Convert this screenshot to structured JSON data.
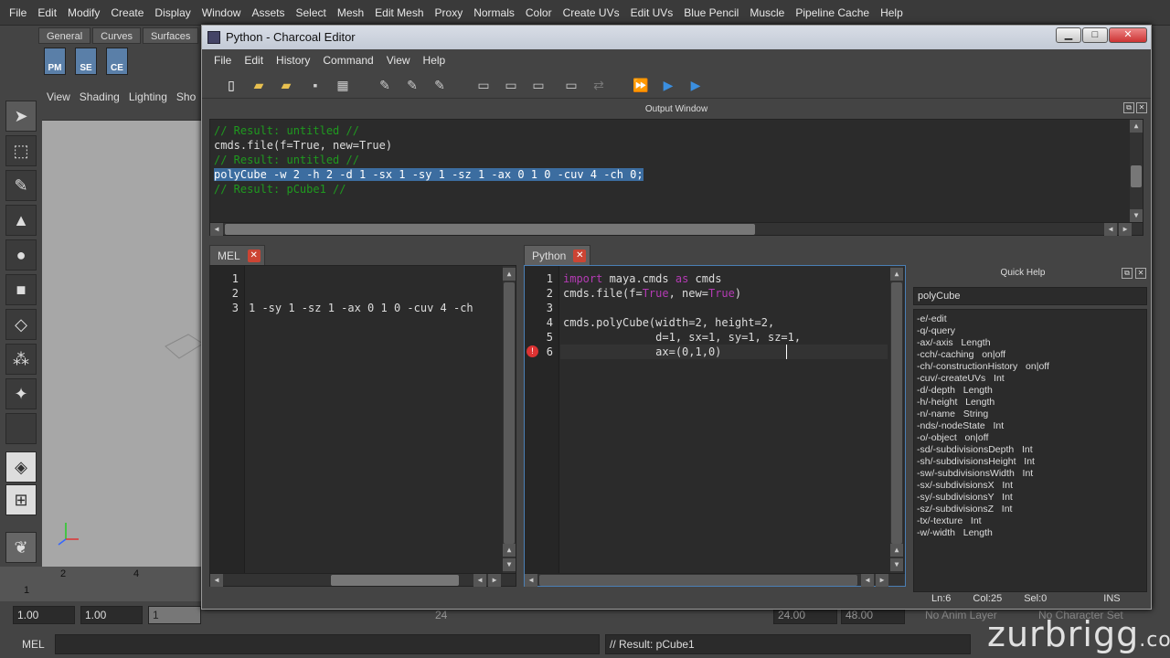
{
  "maya_menu": [
    "File",
    "Edit",
    "Modify",
    "Create",
    "Display",
    "Window",
    "Assets",
    "Select",
    "Mesh",
    "Edit Mesh",
    "Proxy",
    "Normals",
    "Color",
    "Create UVs",
    "Edit UVs",
    "Blue Pencil",
    "Muscle",
    "Pipeline Cache",
    "Help"
  ],
  "shelf": {
    "tabs": [
      "General",
      "Curves",
      "Surfaces"
    ],
    "buttons": [
      "PM",
      "SE",
      "CE"
    ]
  },
  "viewport": {
    "menu": [
      "View",
      "Shading",
      "Lighting",
      "Sho"
    ]
  },
  "timeline": {
    "ticks": [
      "2",
      "4"
    ],
    "current": "1"
  },
  "range": {
    "start": "1.00",
    "start2": "1.00",
    "frame": "1",
    "end_mark": "24",
    "end": "24.00",
    "end2": "48.00",
    "anim_layer": "No Anim Layer",
    "char_set": "No Character Set"
  },
  "cmdline": {
    "label": "MEL",
    "result": "// Result: pCube1"
  },
  "editor": {
    "title": "Python - Charcoal Editor",
    "menu": [
      "File",
      "Edit",
      "History",
      "Command",
      "View",
      "Help"
    ],
    "output_label": "Output Window",
    "output_lines": [
      {
        "text": "// Result: untitled //",
        "style": "cmt"
      },
      {
        "text": "cmds.file(f=True, new=True)",
        "style": "plain"
      },
      {
        "text": "// Result: untitled //",
        "style": "cmt"
      },
      {
        "text": "polyCube -w 2 -h 2 -d 1 -sx 1 -sy 1 -sz 1 -ax 0 1 0 -cuv 4 -ch 0;",
        "style": "sel"
      },
      {
        "text": "// Result: pCube1 //",
        "style": "cmt"
      }
    ],
    "mel_tab": "MEL",
    "mel_lines": [
      "1",
      "2",
      "3"
    ],
    "mel_code": "1 -sy 1 -sz 1 -ax 0 1 0 -cuv 4 -ch",
    "python_tab": "Python",
    "py_lines": [
      "1",
      "2",
      "3",
      "4",
      "5",
      "6"
    ],
    "py_code": {
      "l1_kw": "import",
      "l1_mid": " maya.cmds ",
      "l1_kw2": "as",
      "l1_end": " cmds",
      "l2_a": "cmds.file(f=",
      "l2_b": "True",
      "l2_c": ", new=",
      "l2_d": "True",
      "l2_e": ")",
      "l4": "cmds.polyCube(width=2, height=2,",
      "l5": "              d=1, sx=1, sy=1, sz=1,",
      "l6": "              ax=(0,1,0)"
    },
    "quick_help": {
      "title": "Quick Help",
      "query": "polyCube",
      "items": [
        "-e/-edit",
        "-q/-query",
        "-ax/-axis   Length",
        "-cch/-caching   on|off",
        "-ch/-constructionHistory   on|off",
        "-cuv/-createUVs   Int",
        "-d/-depth   Length",
        "-h/-height   Length",
        "-n/-name   String",
        "-nds/-nodeState   Int",
        "-o/-object   on|off",
        "-sd/-subdivisionsDepth   Int",
        "-sh/-subdivisionsHeight   Int",
        "-sw/-subdivisionsWidth   Int",
        "-sx/-subdivisionsX   Int",
        "-sy/-subdivisionsY   Int",
        "-sz/-subdivisionsZ   Int",
        "-tx/-texture   Int",
        "-w/-width   Length"
      ]
    },
    "status": {
      "ln": "Ln:6",
      "col": "Col:25",
      "sel": "Sel:0",
      "mode": "INS"
    }
  },
  "brand": {
    "text": "zurbrigg",
    "suffix": ".com"
  }
}
